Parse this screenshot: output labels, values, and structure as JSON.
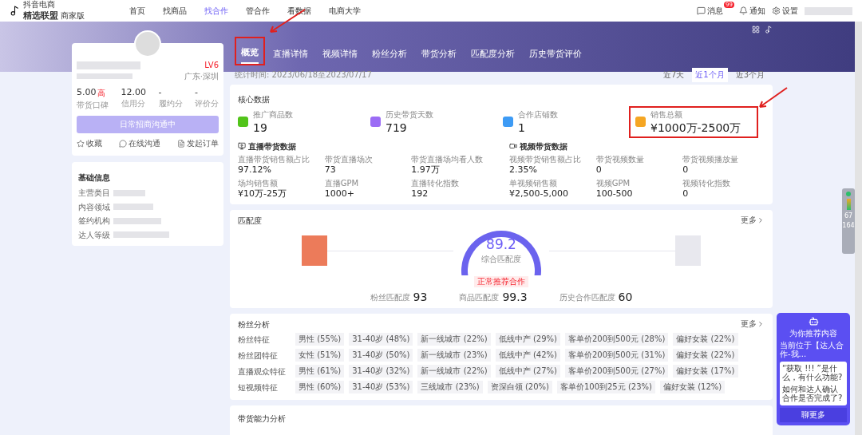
{
  "logo": {
    "small": "抖音电商",
    "name": "精选联盟",
    "edition": "商家版"
  },
  "nav": [
    {
      "label": "首页",
      "selected": false
    },
    {
      "label": "找商品",
      "selected": false
    },
    {
      "label": "找合作",
      "selected": true
    },
    {
      "label": "管合作",
      "selected": false
    },
    {
      "label": "看数据",
      "selected": false
    },
    {
      "label": "电商大学",
      "selected": false
    }
  ],
  "header_actions": [
    {
      "kind": "message",
      "label": "消息",
      "badge": "99"
    },
    {
      "kind": "bell",
      "label": "通知"
    },
    {
      "kind": "gear",
      "label": "设置"
    }
  ],
  "profile": {
    "level_tag": "LV6",
    "location": "广东·深圳",
    "stats": [
      {
        "value": "5.00",
        "unit": "高",
        "label": "带货口碑"
      },
      {
        "value": "12.00",
        "label": "信用分"
      },
      {
        "value": "-",
        "label": "履约分"
      },
      {
        "value": "-",
        "label": "评价分"
      }
    ],
    "status_button": "日常招商沟通中",
    "actions": [
      {
        "kind": "star",
        "label": "收藏"
      },
      {
        "kind": "chat",
        "label": "在线沟通"
      },
      {
        "kind": "order",
        "label": "发起订单"
      }
    ]
  },
  "basic_info": {
    "title": "基础信息",
    "rows": [
      "主营类目",
      "内容领域",
      "签约机构",
      "达人等级"
    ]
  },
  "tabs": [
    {
      "label": "概览",
      "selected": true
    },
    {
      "label": "直播详情",
      "selected": false
    },
    {
      "label": "视频详情",
      "selected": false
    },
    {
      "label": "粉丝分析",
      "selected": false
    },
    {
      "label": "带货分析",
      "selected": false
    },
    {
      "label": "匹配度分析",
      "selected": false
    },
    {
      "label": "历史带货评价",
      "selected": false
    }
  ],
  "period": "统计时间: 2023/06/18至2023/07/17",
  "ranges": [
    {
      "label": "近7天",
      "selected": false
    },
    {
      "label": "近1个月",
      "selected": true
    },
    {
      "label": "近3个月",
      "selected": false
    }
  ],
  "core": {
    "title": "核心数据",
    "metrics": [
      {
        "label": "推广商品数",
        "value": "19",
        "color": "#52c41a"
      },
      {
        "label": "历史带货天数",
        "value": "719",
        "color": "#9b6cf5"
      },
      {
        "label": "合作店铺数",
        "value": "1",
        "color": "#3d9bf5"
      },
      {
        "label": "销售总额",
        "value": "¥1000万-2500万",
        "color": "#f5a623"
      }
    ],
    "groups": [
      {
        "kind": "live",
        "title": "直播带货数据",
        "items": [
          {
            "label": "直播带货销售额占比",
            "value": "97.12%"
          },
          {
            "label": "带货直播场次",
            "value": "73"
          },
          {
            "label": "带货直播场均看人数",
            "value": "1.97万"
          },
          {
            "label": "场均销售额",
            "value": "¥10万-25万"
          },
          {
            "label": "直播GPM",
            "value": "1000+"
          },
          {
            "label": "直播转化指数",
            "value": "192"
          }
        ]
      },
      {
        "kind": "video",
        "title": "视频带货数据",
        "items": [
          {
            "label": "视频带货销售额占比",
            "value": "2.35%"
          },
          {
            "label": "带货视频数量",
            "value": "0"
          },
          {
            "label": "带货视频播放量",
            "value": "0"
          },
          {
            "label": "单视频销售额",
            "value": "¥2,500-5,000"
          },
          {
            "label": "视频GPM",
            "value": "100-500"
          },
          {
            "label": "视频转化指数",
            "value": "0"
          }
        ]
      }
    ]
  },
  "match": {
    "title": "匹配度",
    "more": "更多",
    "score": "89.2",
    "score_label": "综合匹配度",
    "tag": "正常推荐合作",
    "parts": [
      {
        "label": "粉丝匹配度",
        "value": "93"
      },
      {
        "label": "商品匹配度",
        "value": "99.3"
      },
      {
        "label": "历史合作匹配度",
        "value": "60"
      }
    ]
  },
  "fans": {
    "title": "粉丝分析",
    "more": "更多",
    "rows": [
      {
        "label": "粉丝特征",
        "tags": [
          "男性 (55%)",
          "31-40岁 (48%)",
          "新一线城市 (22%)",
          "低线中产 (29%)",
          "客单价200到500元 (28%)",
          "偏好女装 (22%)"
        ]
      },
      {
        "label": "粉丝团特征",
        "tags": [
          "女性 (51%)",
          "31-40岁 (50%)",
          "新一线城市 (23%)",
          "低线中产 (42%)",
          "客单价200到500元 (31%)",
          "偏好女装 (22%)"
        ]
      },
      {
        "label": "直播观众特征",
        "tags": [
          "男性 (61%)",
          "31-40岁 (32%)",
          "新一线城市 (22%)",
          "低线中产 (27%)",
          "客单价200到500元 (27%)",
          "偏好女装 (17%)"
        ]
      },
      {
        "label": "短视频特征",
        "tags": [
          "男性 (60%)",
          "31-40岁 (53%)",
          "三线城市 (23%)",
          "资深白领 (20%)",
          "客单价100到25元 (23%)",
          "偏好女装 (12%)"
        ]
      }
    ]
  },
  "next_card": {
    "title": "带货能力分析"
  },
  "side_widget": [
    "67",
    "164"
  ],
  "assistant": {
    "title": "为你推荐内容",
    "subtitle": "当前位于【达人合作-我...",
    "questions": [
      "“获取 !!! ”是什么，有什么功能?",
      "如何和达人确认合作是否完成了?"
    ],
    "button": "聊更多"
  }
}
